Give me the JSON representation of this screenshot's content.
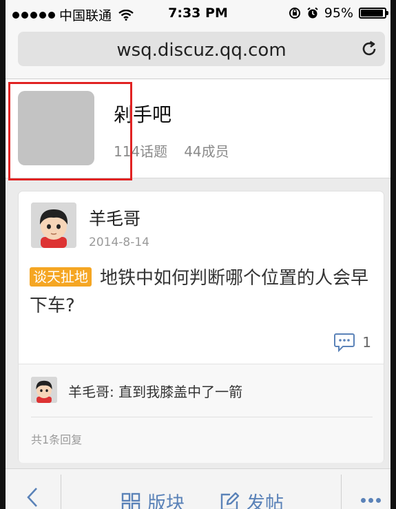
{
  "status_bar": {
    "carrier": "中国联通",
    "time": "7:33 PM",
    "battery": "95%",
    "battery_level": 0.95
  },
  "browser": {
    "url": "wsq.discuz.qq.com"
  },
  "group": {
    "name": "剁手吧",
    "topics": "114话题",
    "members": "44成员"
  },
  "post": {
    "author": "羊毛哥",
    "date": "2014-8-14",
    "tag": "谈天扯地",
    "title": "地铁中如何判断哪个位置的人会早下车?",
    "comment_count": "1"
  },
  "reply": {
    "text": "羊毛哥: 直到我膝盖中了一箭",
    "total": "共1条回复"
  },
  "toolbar": {
    "boards_label": "版块",
    "post_label": "发帖"
  },
  "colors": {
    "tag": "#f5a623",
    "highlight": "#e12222",
    "toolbar_accent": "#5a82b8"
  }
}
